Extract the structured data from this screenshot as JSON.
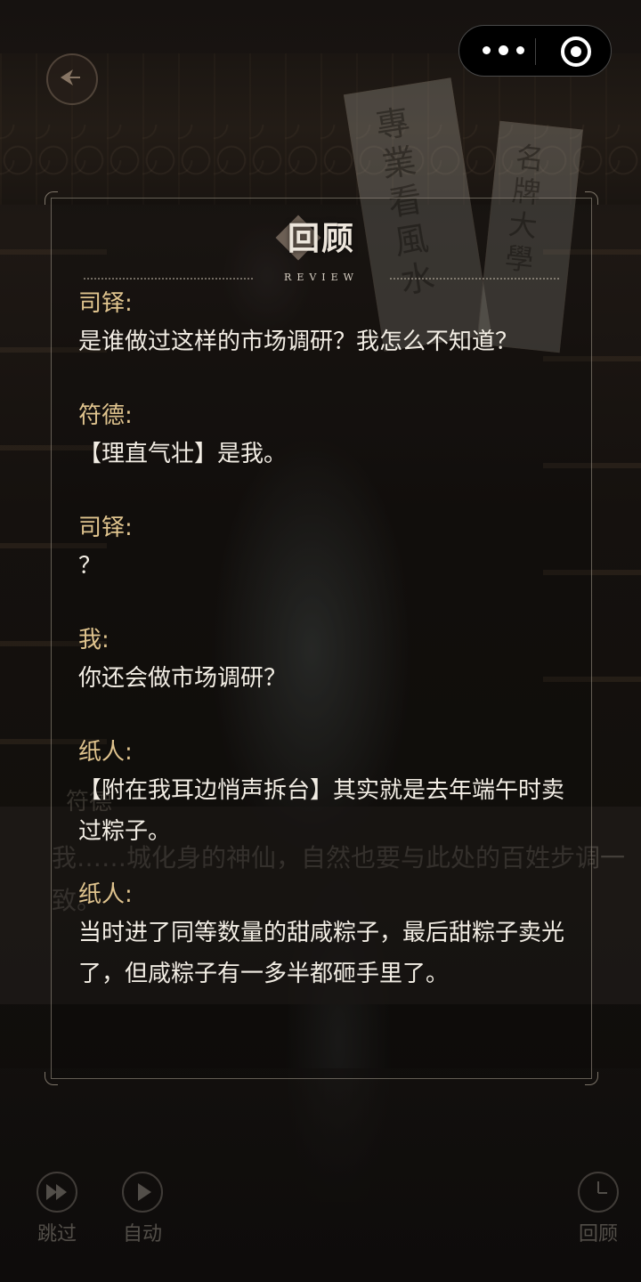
{
  "scene": {
    "banner_left_text": "專業看風水",
    "banner_right_text": "名牌大學",
    "underlying_speaker": "符德",
    "underlying_text": "我……城化身的神仙，自然也要与此处的百姓步调一致。"
  },
  "capsule": {
    "more_icon": "more-dots-icon",
    "close_icon": "target-circle-icon"
  },
  "review": {
    "title": "回顾",
    "subtitle": "REVIEW",
    "entries": [
      {
        "speaker": "司铎:",
        "text": "是谁做过这样的市场调研？我怎么不知道？"
      },
      {
        "speaker": "符德:",
        "text": "【理直气壮】是我。"
      },
      {
        "speaker": "司铎:",
        "text": "？"
      },
      {
        "speaker": "我:",
        "text": "你还会做市场调研？"
      },
      {
        "speaker": "纸人:",
        "text": "【附在我耳边悄声拆台】其实就是去年端午时卖过粽子。"
      },
      {
        "speaker": "纸人:",
        "text": "当时进了同等数量的甜咸粽子，最后甜粽子卖光了，但咸粽子有一多半都砸手里了。"
      }
    ]
  },
  "controls": {
    "skip_label": "跳过",
    "auto_label": "自动",
    "review_label": "回顾"
  },
  "colors": {
    "speaker": "#e0c48e",
    "text": "#f2ede4",
    "panel_border": "#aaa091"
  }
}
